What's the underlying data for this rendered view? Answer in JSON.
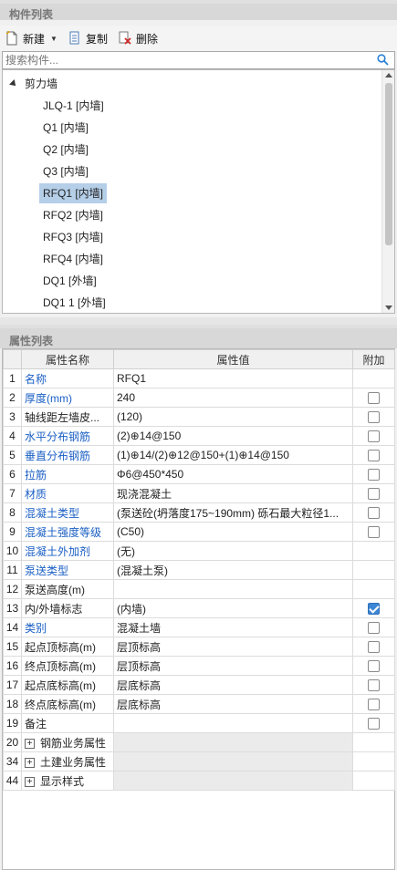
{
  "component_list": {
    "title": "构件列表",
    "toolbar": {
      "new_label": "新建",
      "copy_label": "复制",
      "delete_label": "删除"
    },
    "search_placeholder": "搜索构件...",
    "tree": {
      "root_label": "剪力墙",
      "items": [
        {
          "label": "JLQ-1 [内墙]",
          "selected": false
        },
        {
          "label": "Q1 [内墙]",
          "selected": false
        },
        {
          "label": "Q2 [内墙]",
          "selected": false
        },
        {
          "label": "Q3 [内墙]",
          "selected": false
        },
        {
          "label": "RFQ1 [内墙]",
          "selected": true
        },
        {
          "label": "RFQ2 [内墙]",
          "selected": false
        },
        {
          "label": "RFQ3 [内墙]",
          "selected": false
        },
        {
          "label": "RFQ4 [内墙]",
          "selected": false
        },
        {
          "label": "DQ1 [外墙]",
          "selected": false
        },
        {
          "label": "DQ1 1 [外墙]",
          "selected": false
        }
      ]
    }
  },
  "property_list": {
    "title": "属性列表",
    "columns": {
      "name": "属性名称",
      "value": "属性值",
      "extra": "附加"
    },
    "rows": [
      {
        "num": "1",
        "name": "名称",
        "value": "RFQ1",
        "blue": true,
        "check": null
      },
      {
        "num": "2",
        "name": "厚度(mm)",
        "value": "240",
        "blue": true,
        "check": false
      },
      {
        "num": "3",
        "name": "轴线距左墙皮...",
        "value": "(120)",
        "blue": false,
        "check": false
      },
      {
        "num": "4",
        "name": "水平分布钢筋",
        "value": "(2)⊕14@150",
        "blue": true,
        "check": false
      },
      {
        "num": "5",
        "name": "垂直分布钢筋",
        "value": "(1)⊕14/(2)⊕12@150+(1)⊕14@150",
        "blue": true,
        "check": false
      },
      {
        "num": "6",
        "name": "拉筋",
        "value": "Φ6@450*450",
        "blue": true,
        "check": false
      },
      {
        "num": "7",
        "name": "材质",
        "value": "现浇混凝土",
        "blue": true,
        "check": false
      },
      {
        "num": "8",
        "name": "混凝土类型",
        "value": "(泵送砼(坍落度175~190mm) 砾石最大粒径1...",
        "blue": true,
        "check": false
      },
      {
        "num": "9",
        "name": "混凝土强度等级",
        "value": "(C50)",
        "blue": true,
        "check": false
      },
      {
        "num": "10",
        "name": "混凝土外加剂",
        "value": "(无)",
        "blue": true,
        "check": null
      },
      {
        "num": "11",
        "name": "泵送类型",
        "value": "(混凝土泵)",
        "blue": true,
        "check": null
      },
      {
        "num": "12",
        "name": "泵送高度(m)",
        "value": "",
        "blue": false,
        "check": null
      },
      {
        "num": "13",
        "name": "内/外墙标志",
        "value": "(内墙)",
        "blue": false,
        "check": true
      },
      {
        "num": "14",
        "name": "类别",
        "value": "混凝土墙",
        "blue": true,
        "check": false
      },
      {
        "num": "15",
        "name": "起点顶标高(m)",
        "value": "层顶标高",
        "blue": false,
        "check": false
      },
      {
        "num": "16",
        "name": "终点顶标高(m)",
        "value": "层顶标高",
        "blue": false,
        "check": false
      },
      {
        "num": "17",
        "name": "起点底标高(m)",
        "value": "层底标高",
        "blue": false,
        "check": false
      },
      {
        "num": "18",
        "name": "终点底标高(m)",
        "value": "层底标高",
        "blue": false,
        "check": false
      },
      {
        "num": "19",
        "name": "备注",
        "value": "",
        "blue": false,
        "check": false
      }
    ],
    "groups": [
      {
        "num": "20",
        "name": "钢筋业务属性"
      },
      {
        "num": "34",
        "name": "土建业务属性"
      },
      {
        "num": "44",
        "name": "显示样式"
      }
    ]
  }
}
